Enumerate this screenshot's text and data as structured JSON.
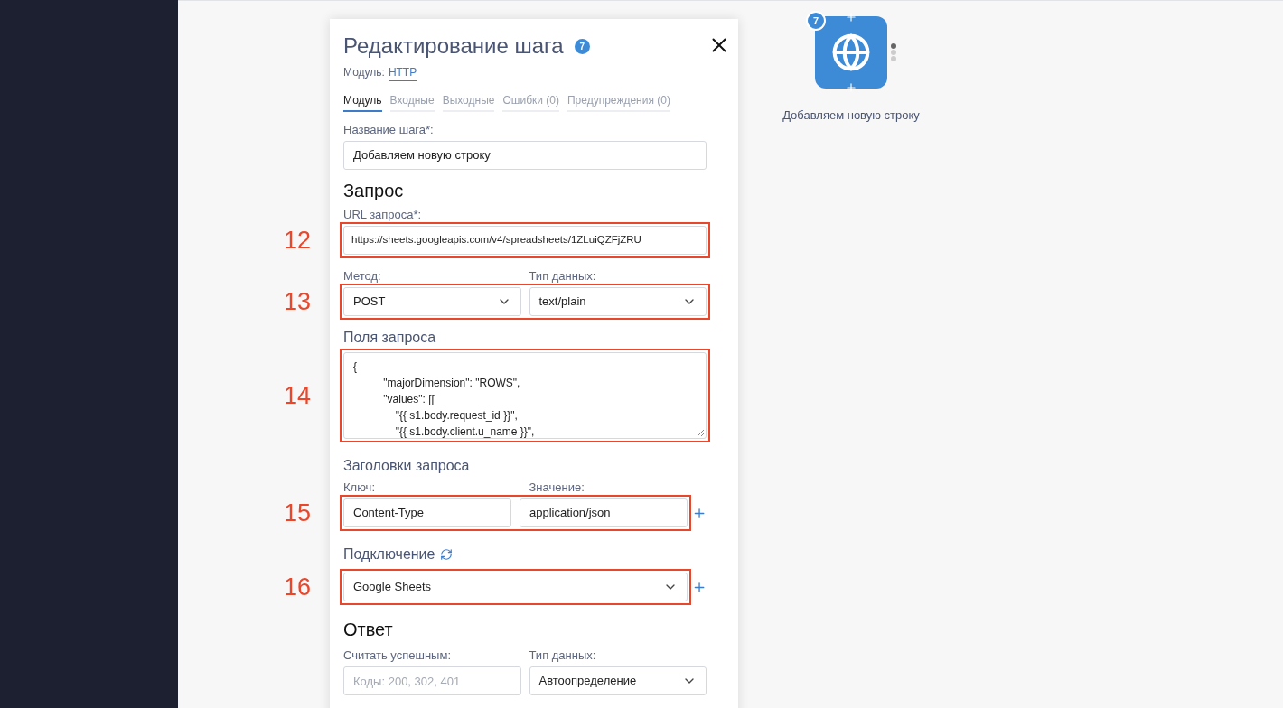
{
  "canvas_node": {
    "badge": "7",
    "label": "Добавляем новую строку"
  },
  "dialog": {
    "title": "Редактирование шага",
    "badge": "7",
    "module_label": "Модуль:",
    "module_link": "HTTP",
    "tabs": [
      {
        "label": "Модуль",
        "selected": true
      },
      {
        "label": "Входные",
        "selected": false
      },
      {
        "label": "Выходные",
        "selected": false
      },
      {
        "label": "Ошибки (0)",
        "selected": false
      },
      {
        "label": "Предупреждения (0)",
        "selected": false
      }
    ],
    "step_name": {
      "label": "Название шага*:",
      "value": "Добавляем новую строку"
    },
    "request": {
      "heading": "Запрос",
      "url": {
        "annotation": "12",
        "label": "URL запроса*:",
        "value": "https://sheets.googleapis.com/v4/spreadsheets/1ZLuiQZFjZRU"
      },
      "method_row": {
        "annotation": "13",
        "method_label": "Метод:",
        "method_value": "POST",
        "type_label": "Тип данных:",
        "type_value": "text/plain"
      },
      "body": {
        "heading": "Поля запроса",
        "annotation": "14",
        "lines": [
          "{",
          "          \"majorDimension\": \"ROWS\",",
          "          \"values\": [[",
          "              \"{{ s1.body.request_id }}\",",
          "              \"{{ s1.body.client.u_name }}\","
        ]
      },
      "headers": {
        "heading": "Заголовки запроса",
        "key_label": "Ключ:",
        "value_label": "Значение:",
        "annotation": "15",
        "key": "Content-Type",
        "value": "application/json"
      },
      "connection": {
        "heading": "Подключение",
        "annotation": "16",
        "value": "Google Sheets"
      }
    },
    "response": {
      "heading": "Ответ",
      "success_label": "Считать успешным:",
      "success_placeholder": "Коды: 200, 302, 401",
      "type_label": "Тип данных:",
      "type_value": "Автоопределение"
    }
  }
}
